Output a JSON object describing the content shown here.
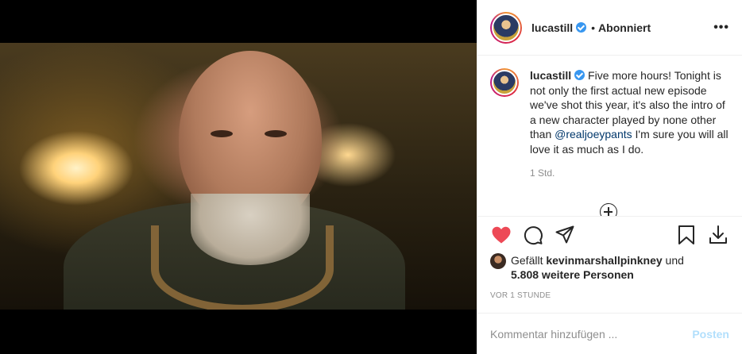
{
  "header": {
    "username": "lucastill",
    "follow_status": "Abonniert",
    "separator": "•",
    "more_glyph": "•••"
  },
  "caption": {
    "username": "lucastill",
    "text_before_mention": "Five more hours! Tonight is not only the first actual new episode we've shot this year, it's also the intro of a new character played by none other than",
    "mention": "@realjoeypants",
    "text_after_mention": "I'm sure you will all love it as much as I do.",
    "time": "1 Std."
  },
  "likes": {
    "prefix": "Gefällt",
    "liked_by": "kevinmarshallpinkney",
    "conjunction": "und",
    "others": "5.808 weitere Personen"
  },
  "date": "VOR 1 STUNDE",
  "comment": {
    "placeholder": "Kommentar hinzufügen ...",
    "post_label": "Posten"
  },
  "colors": {
    "like_red": "#ed4956",
    "verified_blue": "#3897f0",
    "post_disabled": "#b2dffc",
    "mention": "#00376b"
  },
  "icons": [
    "verified-badge-icon",
    "more-icon",
    "load-more-comments-icon",
    "heart-icon",
    "comment-icon",
    "share-icon",
    "bookmark-icon",
    "download-icon"
  ]
}
